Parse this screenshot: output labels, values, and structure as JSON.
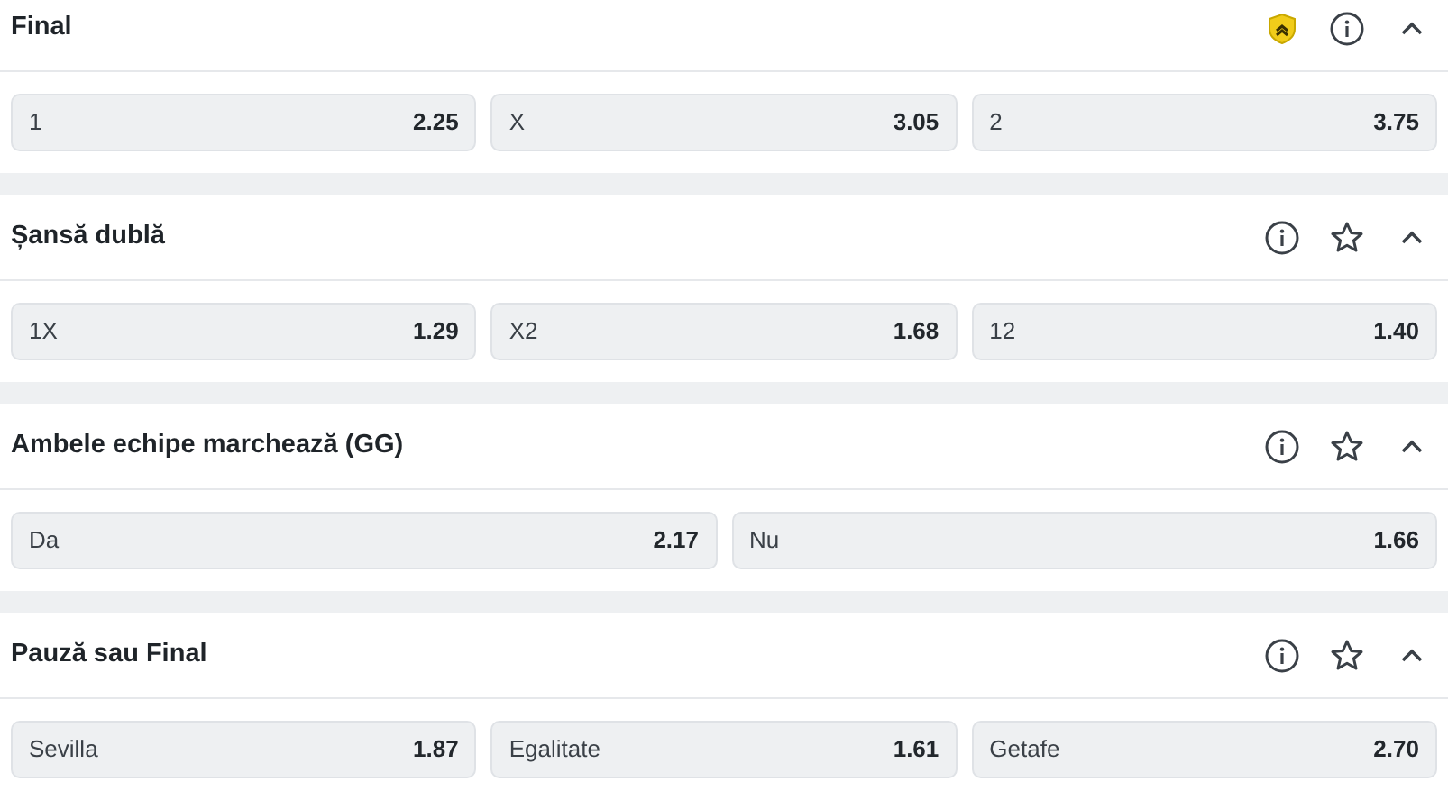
{
  "markets": [
    {
      "title": "Final",
      "kind": "boosted",
      "expanded": true,
      "outcomes": [
        {
          "label": "1",
          "odds": "2.25"
        },
        {
          "label": "X",
          "odds": "3.05"
        },
        {
          "label": "2",
          "odds": "3.75"
        }
      ]
    },
    {
      "title": "Șansă dublă",
      "kind": "standard",
      "expanded": true,
      "outcomes": [
        {
          "label": "1X",
          "odds": "1.29"
        },
        {
          "label": "X2",
          "odds": "1.68"
        },
        {
          "label": "12",
          "odds": "1.40"
        }
      ]
    },
    {
      "title": "Ambele echipe marchează (GG)",
      "kind": "standard",
      "expanded": true,
      "outcomes": [
        {
          "label": "Da",
          "odds": "2.17"
        },
        {
          "label": "Nu",
          "odds": "1.66"
        }
      ]
    },
    {
      "title": "Pauză sau Final",
      "kind": "standard",
      "expanded": true,
      "outcomes": [
        {
          "label": "Sevilla",
          "odds": "1.87"
        },
        {
          "label": "Egalitate",
          "odds": "1.61"
        },
        {
          "label": "Getafe",
          "odds": "2.70"
        }
      ]
    }
  ]
}
